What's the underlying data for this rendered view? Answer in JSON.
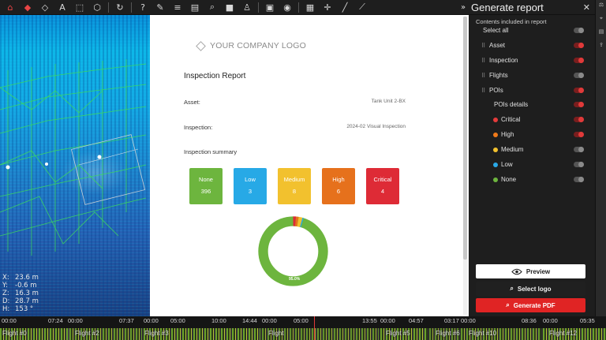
{
  "toolbar": {
    "buttons": [
      {
        "name": "home-icon",
        "glyph": "⌂",
        "red": true
      },
      {
        "name": "cube-red-icon",
        "glyph": "◆",
        "red": true
      },
      {
        "name": "cube-white-icon",
        "glyph": "◇",
        "red": false
      },
      {
        "name": "text-tool-icon",
        "glyph": "A",
        "red": false
      },
      {
        "name": "frame-tool-icon",
        "glyph": "⬚",
        "red": false
      },
      {
        "name": "box-tool-icon",
        "glyph": "⬡",
        "red": false
      },
      {
        "name": "sync-icon",
        "glyph": "↻",
        "red": false
      },
      {
        "name": "help-icon",
        "glyph": "?",
        "red": false
      },
      {
        "name": "pencil-icon",
        "glyph": "✎",
        "red": false
      },
      {
        "name": "sliders-icon",
        "glyph": "≡",
        "red": false
      },
      {
        "name": "layers-icon",
        "glyph": "▤",
        "red": false
      },
      {
        "name": "zoom-icon",
        "glyph": "⌕",
        "red": false
      },
      {
        "name": "video-icon",
        "glyph": "■",
        "red": false
      },
      {
        "name": "person-icon",
        "glyph": "♙",
        "red": false
      },
      {
        "name": "calendar-icon",
        "glyph": "▣",
        "red": false
      },
      {
        "name": "camera-icon",
        "glyph": "◉",
        "red": false
      },
      {
        "name": "grid-icon",
        "glyph": "▦",
        "red": false
      },
      {
        "name": "crosshair-icon",
        "glyph": "✛",
        "red": false
      },
      {
        "name": "line-icon",
        "glyph": "╱",
        "red": false
      },
      {
        "name": "ruler-icon",
        "glyph": "⟋",
        "red": false
      }
    ]
  },
  "viewport": {
    "coords": [
      {
        "k": "X:",
        "v": "23.6 m"
      },
      {
        "k": "Y:",
        "v": "-0.6 m"
      },
      {
        "k": "Z:",
        "v": "16.3 m"
      },
      {
        "k": "D:",
        "v": "28.7 m"
      },
      {
        "k": "H:",
        "v": "153 °"
      }
    ]
  },
  "document": {
    "logo_text": "YOUR COMPANY LOGO",
    "title": "Inspection Report",
    "asset_label": "Asset:",
    "asset_value": "Tank Unit 2-BX",
    "inspection_label": "Inspection:",
    "inspection_value": "2024-02 Visual Inspection",
    "summary_label": "Inspection summary",
    "cards": [
      {
        "label": "None",
        "count": "396",
        "color": "#6db53e"
      },
      {
        "label": "Low",
        "count": "3",
        "color": "#27a9e6"
      },
      {
        "label": "Medium",
        "count": "8",
        "color": "#f2c12e"
      },
      {
        "label": "High",
        "count": "6",
        "color": "#e6711c"
      },
      {
        "label": "Critical",
        "count": "4",
        "color": "#de2b36"
      }
    ],
    "donut_label": "95.0%"
  },
  "panel": {
    "title": "Generate report",
    "collapse_glyph": "»",
    "close_glyph": "✕",
    "contents_label": "Contents included in report",
    "select_all": "Select all",
    "sections": [
      {
        "label": "Asset",
        "on": true
      },
      {
        "label": "Inspection",
        "on": true
      },
      {
        "label": "Flights",
        "on": false
      },
      {
        "label": "POIs",
        "on": true
      }
    ],
    "poi_details_label": "POIs details",
    "poi_levels": [
      {
        "label": "Critical",
        "color": "#e53b3b",
        "on": true
      },
      {
        "label": "High",
        "color": "#f07a1a",
        "on": true
      },
      {
        "label": "Medium",
        "color": "#f2c12e",
        "on": false
      },
      {
        "label": "Low",
        "color": "#2aa9e8",
        "on": false
      },
      {
        "label": "None",
        "color": "#6db53e",
        "on": false
      }
    ],
    "preview_label": "Preview",
    "select_logo_label": "Select logo",
    "generate_pdf_label": "Generate PDF"
  },
  "timeline": {
    "times": [
      "00:00",
      "07:24",
      "00:00",
      "07:37",
      "00:00",
      "05:00",
      "10:00",
      "14:44",
      "00:00",
      "05:00",
      "13:55",
      "00:00",
      "04:57",
      "03:17",
      "00:00",
      "08:36",
      "00:00",
      "05:35"
    ],
    "flights": [
      "Flight #0",
      "Flight #2",
      "Flight #3",
      "Flight",
      "Flight #5",
      "Flight #6",
      "Flight #10",
      "Flight #12"
    ]
  }
}
